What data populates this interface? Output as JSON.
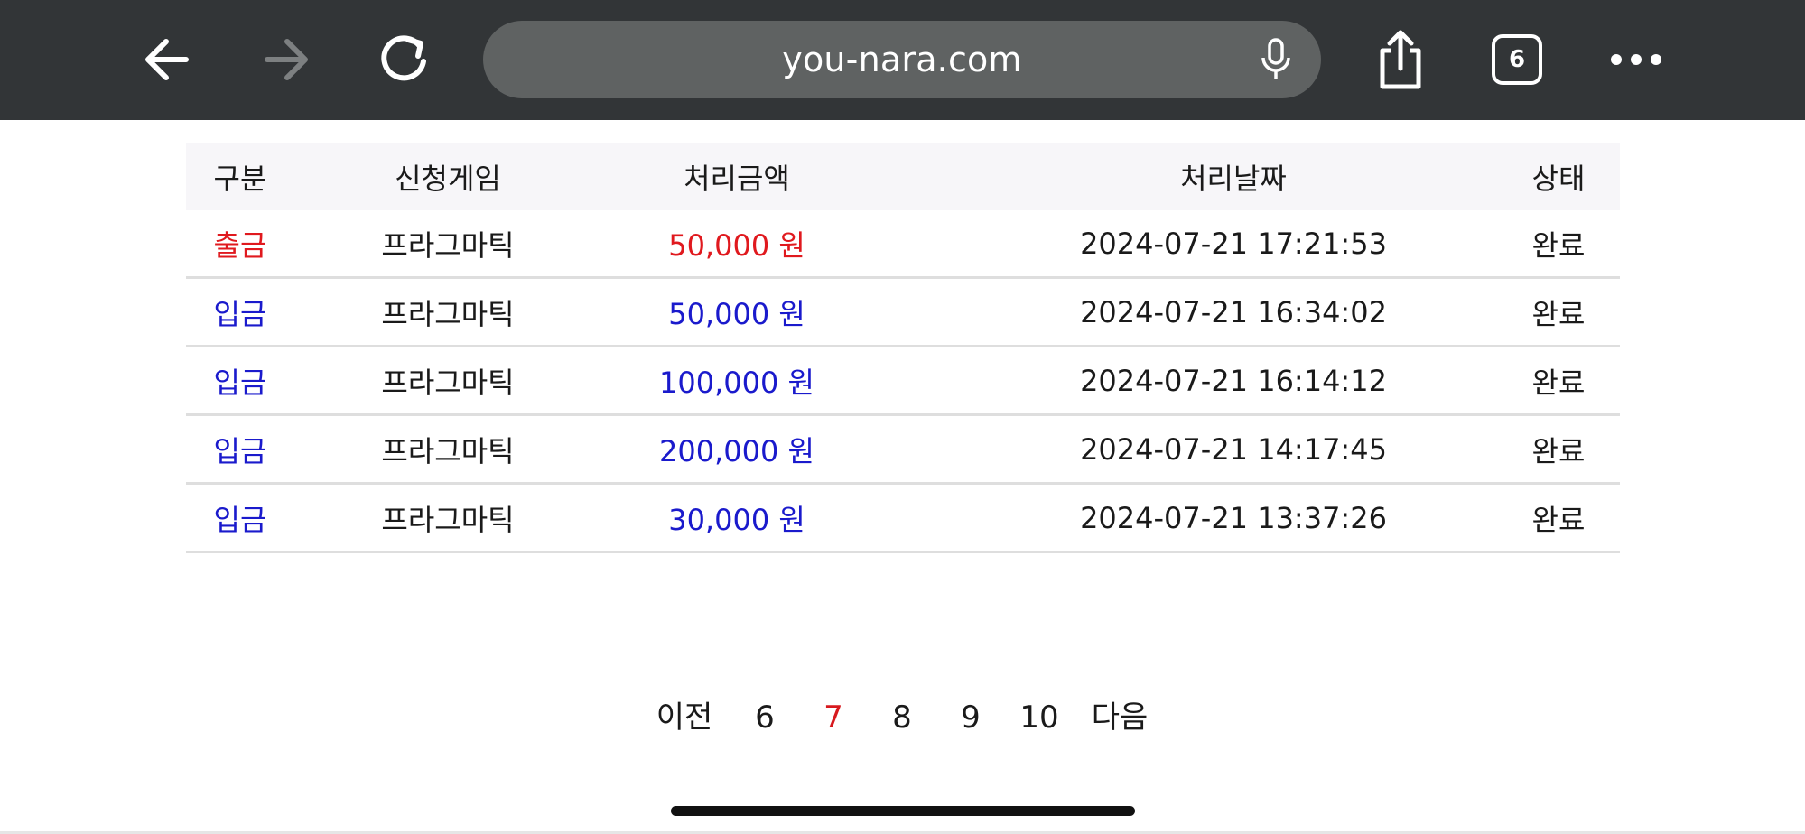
{
  "browser": {
    "url": "you-nara.com",
    "tab_count": "6",
    "icons": {
      "back": "back-arrow-icon",
      "forward": "forward-arrow-icon",
      "reload": "reload-icon",
      "mic": "microphone-icon",
      "share": "share-icon",
      "tabs": "tabs-icon",
      "more": "more-icon"
    }
  },
  "table": {
    "headers": [
      "구분",
      "신청게임",
      "처리금액",
      "처리날짜",
      "상태"
    ],
    "rows": [
      {
        "type": "출금",
        "game": "프라그마틱",
        "amount": "50,000 원",
        "date": "2024-07-21 17:21:53",
        "status": "완료",
        "kind": "out"
      },
      {
        "type": "입금",
        "game": "프라그마틱",
        "amount": "50,000 원",
        "date": "2024-07-21 16:34:02",
        "status": "완료",
        "kind": "in"
      },
      {
        "type": "입금",
        "game": "프라그마틱",
        "amount": "100,000 원",
        "date": "2024-07-21 16:14:12",
        "status": "완료",
        "kind": "in"
      },
      {
        "type": "입금",
        "game": "프라그마틱",
        "amount": "200,000 원",
        "date": "2024-07-21 14:17:45",
        "status": "완료",
        "kind": "in"
      },
      {
        "type": "입금",
        "game": "프라그마틱",
        "amount": "30,000 원",
        "date": "2024-07-21 13:37:26",
        "status": "완료",
        "kind": "in"
      }
    ]
  },
  "pagination": {
    "prev": "이전",
    "pages": [
      "6",
      "7",
      "8",
      "9",
      "10"
    ],
    "current": "7",
    "next": "다음"
  },
  "colors": {
    "withdraw": "#e0191e",
    "deposit": "#1a1acc",
    "active_page": "#d7191e",
    "toolbar_bg": "#323537"
  }
}
